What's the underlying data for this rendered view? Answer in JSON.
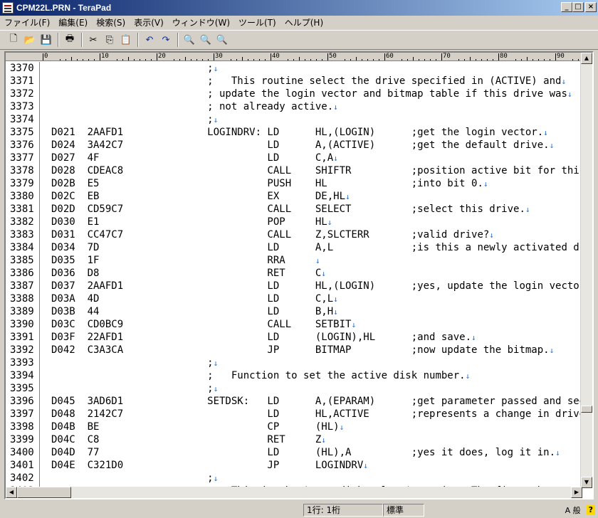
{
  "window": {
    "title": "CPM22L.PRN - TeraPad"
  },
  "menubar": [
    "ファイル(F)",
    "編集(E)",
    "検索(S)",
    "表示(V)",
    "ウィンドウ(W)",
    "ツール(T)",
    "ヘルプ(H)"
  ],
  "toolbar": [
    "new-file-icon",
    "open-folder-icon",
    "save-icon",
    "print-icon",
    "cut-icon",
    "copy-icon",
    "paste-icon",
    "undo-icon",
    "redo-icon",
    "find-icon",
    "find-prev-icon",
    "find-next-icon"
  ],
  "ruler": [
    "0",
    "10",
    "20",
    "30",
    "40",
    "50",
    "60",
    "70",
    "80",
    "90"
  ],
  "lines": [
    {
      "n": "3370",
      "t": "                          ;↓"
    },
    {
      "n": "3371",
      "t": "                          ;   This routine select the drive specified in (ACTIVE) and↓"
    },
    {
      "n": "3372",
      "t": "                          ; update the login vector and bitmap table if this drive was↓"
    },
    {
      "n": "3373",
      "t": "                          ; not already active.↓"
    },
    {
      "n": "3374",
      "t": "                          ;↓"
    },
    {
      "n": "3375",
      "t": "D021  2AAFD1              LOGINDRV: LD      HL,(LOGIN)      ;get the login vector.↓"
    },
    {
      "n": "3376",
      "t": "D024  3A42C7                        LD      A,(ACTIVE)      ;get the default drive.↓"
    },
    {
      "n": "3377",
      "t": "D027  4F                            LD      C,A↓"
    },
    {
      "n": "3378",
      "t": "D028  CDEAC8                        CALL    SHIFTR          ;position active bit for this drive↓"
    },
    {
      "n": "3379",
      "t": "D02B  E5                            PUSH    HL              ;into bit 0.↓"
    },
    {
      "n": "3380",
      "t": "D02C  EB                            EX      DE,HL↓"
    },
    {
      "n": "3381",
      "t": "D02D  CD59C7                        CALL    SELECT          ;select this drive.↓"
    },
    {
      "n": "3382",
      "t": "D030  E1                            POP     HL↓"
    },
    {
      "n": "3383",
      "t": "D031  CC47C7                        CALL    Z,SLCTERR       ;valid drive?↓"
    },
    {
      "n": "3384",
      "t": "D034  7D                            LD      A,L             ;is this a newly activated drive?↓"
    },
    {
      "n": "3385",
      "t": "D035  1F                            RRA     ↓"
    },
    {
      "n": "3386",
      "t": "D036  D8                            RET     C↓"
    },
    {
      "n": "3387",
      "t": "D037  2AAFD1                        LD      HL,(LOGIN)      ;yes, update the login vector.↓"
    },
    {
      "n": "3388",
      "t": "D03A  4D                            LD      C,L↓"
    },
    {
      "n": "3389",
      "t": "D03B  44                            LD      B,H↓"
    },
    {
      "n": "3390",
      "t": "D03C  CD0BC9                        CALL    SETBIT↓"
    },
    {
      "n": "3391",
      "t": "D03F  22AFD1                        LD      (LOGIN),HL      ;and save.↓"
    },
    {
      "n": "3392",
      "t": "D042  C3A3CA                        JP      BITMAP          ;now update the bitmap.↓"
    },
    {
      "n": "3393",
      "t": "                          ;↓"
    },
    {
      "n": "3394",
      "t": "                          ;   Function to set the active disk number.↓"
    },
    {
      "n": "3395",
      "t": "                          ;↓"
    },
    {
      "n": "3396",
      "t": "D045  3AD6D1              SETDSK:   LD      A,(EPARAM)      ;get parameter passed and see if this↓"
    },
    {
      "n": "3397",
      "t": "D048  2142C7                        LD      HL,ACTIVE       ;represents a change in drives.↓"
    },
    {
      "n": "3398",
      "t": "D04B  BE                            CP      (HL)↓"
    },
    {
      "n": "3399",
      "t": "D04C  C8                            RET     Z↓"
    },
    {
      "n": "3400",
      "t": "D04D  77                            LD      (HL),A          ;yes it does, log it in.↓"
    },
    {
      "n": "3401",
      "t": "D04E  C321D0                        JP      LOGINDRV↓"
    },
    {
      "n": "3402",
      "t": "                          ;↓"
    },
    {
      "n": "3403",
      "t": "                          ;   This is the 'auto disk select' routine. The firsst byte"
    }
  ],
  "statusbar": {
    "position": "1行:  1桁",
    "mode": "標準"
  },
  "tray": {
    "ime": "A 般",
    "extra": "?"
  }
}
